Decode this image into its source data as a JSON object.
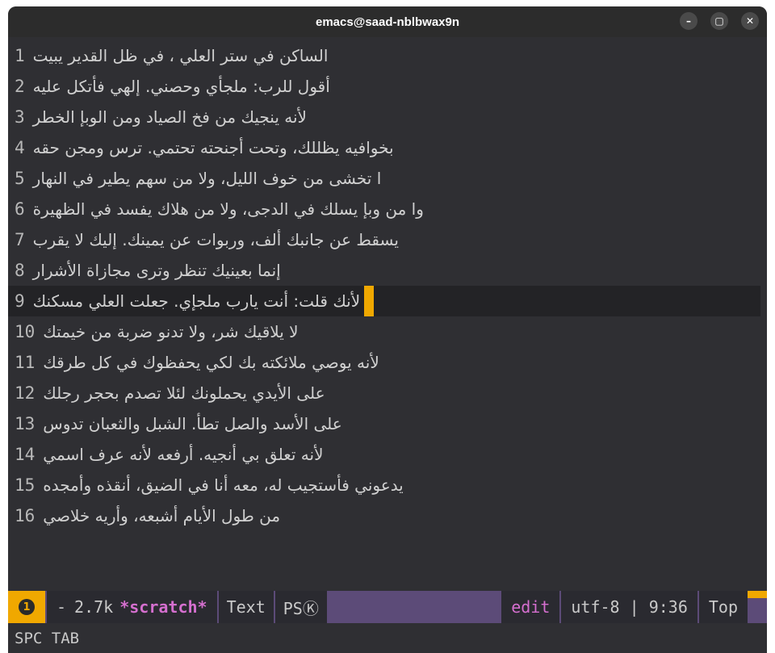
{
  "window": {
    "title": "emacs@saad-nblbwax9n",
    "minimize_glyph": "–",
    "maximize_glyph": "▢",
    "close_glyph": "✕"
  },
  "editor": {
    "current_line": 9,
    "lines": [
      {
        "num": "1",
        "text": "الساكن في ستر العلي ، في ظل القدير يبيت"
      },
      {
        "num": "2",
        "text": "أقول للرب: ملجأي وحصني. إلهي فأتكل عليه"
      },
      {
        "num": "3",
        "text": "لأنه ينجيك من فخ الصياد ومن الوبإ الخطر"
      },
      {
        "num": "4",
        "text": "بخوافيه يظللك، وتحت أجنحته تحتمي. ترس ومجن حقه"
      },
      {
        "num": "5",
        "text": "ا تخشى من خوف الليل، ولا من سهم يطير في النهار"
      },
      {
        "num": "6",
        "text": "وا من وبإ يسلك في الدجى، ولا من هلاك يفسد في الظهيرة"
      },
      {
        "num": "7",
        "text": "يسقط عن جانبك ألف، وربوات عن يمينك. إليك لا يقرب"
      },
      {
        "num": "8",
        "text": "إنما بعينيك تنظر وترى مجازاة الأشرار"
      },
      {
        "num": "9",
        "text": "لأنك قلت: أنت يارب ملجإي. جعلت العلي مسكنك"
      },
      {
        "num": "10",
        "text": "لا يلاقيك شر، ولا تدنو ضربة من خيمتك"
      },
      {
        "num": "11",
        "text": "لأنه يوصي ملائكته بك لكي يحفظوك في كل طرقك"
      },
      {
        "num": "12",
        "text": "على الأيدي يحملونك لئلا تصدم بحجر رجلك"
      },
      {
        "num": "13",
        "text": "على الأسد والصل تطأ. الشبل والثعبان تدوس"
      },
      {
        "num": "14",
        "text": "لأنه تعلق بي أنجيه. أرفعه لأنه عرف اسمي"
      },
      {
        "num": "15",
        "text": "يدعوني فأستجيب له، معه أنا في الضيق، أنقذه وأمجده"
      },
      {
        "num": "16",
        "text": "من طول الأيام أشبعه، وأريه خلاصي"
      }
    ]
  },
  "modeline": {
    "badge": "1",
    "state": "-",
    "size": "2.7k",
    "buffer": "*scratch*",
    "major_mode": "Text",
    "minor_mode": "PSⓀ",
    "evil_state": "edit",
    "encoding_pos": "utf-8 | 9:36",
    "scroll": "Top"
  },
  "echo_area": {
    "text": "SPC TAB"
  },
  "colors": {
    "accent": "#f0a800",
    "modeline_bg": "#5c4b78",
    "buffer_name": "#d56fcf",
    "editor_bg": "#2f2f33"
  }
}
